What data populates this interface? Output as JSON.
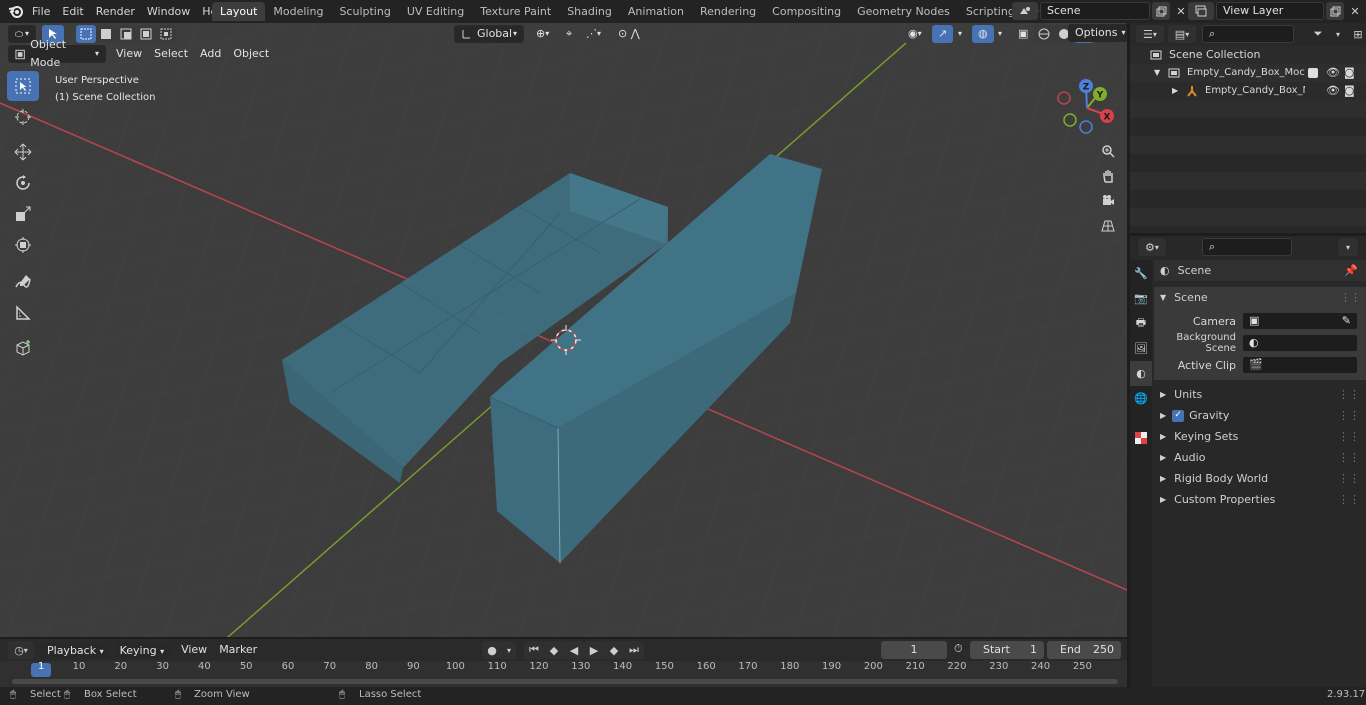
{
  "topbar": {
    "menus": [
      "File",
      "Edit",
      "Render",
      "Window",
      "Help"
    ],
    "workspaces": [
      "Layout",
      "Modeling",
      "Sculpting",
      "UV Editing",
      "Texture Paint",
      "Shading",
      "Animation",
      "Rendering",
      "Compositing",
      "Geometry Nodes",
      "Scripting"
    ],
    "active_workspace": "Layout",
    "scene_name": "Scene",
    "view_layer": "View Layer"
  },
  "viewport": {
    "mode": "Object Mode",
    "menus": [
      "View",
      "Select",
      "Add",
      "Object"
    ],
    "transform_orientation": "Global",
    "options_label": "Options",
    "overlay_line1": "User Perspective",
    "overlay_line2": "(1) Scene Collection",
    "gizmo_axes": [
      "X",
      "Y",
      "Z"
    ]
  },
  "outliner": {
    "search_placeholder": "",
    "items": [
      {
        "label": "Scene Collection"
      },
      {
        "label": "Empty_Candy_Box_Mockup_t"
      },
      {
        "label": "Empty_Candy_Box_Mock"
      }
    ]
  },
  "properties": {
    "context_label": "Scene",
    "section_label": "Scene",
    "fields": [
      {
        "label": "Camera"
      },
      {
        "label": "Background Scene"
      },
      {
        "label": "Active Clip"
      }
    ],
    "panels": [
      {
        "label": "Units"
      },
      {
        "label": "Gravity",
        "checked": true
      },
      {
        "label": "Keying Sets"
      },
      {
        "label": "Audio"
      },
      {
        "label": "Rigid Body World"
      },
      {
        "label": "Custom Properties"
      }
    ]
  },
  "timeline": {
    "menus": [
      "Playback",
      "Keying",
      "View",
      "Marker"
    ],
    "current_frame": "1",
    "start_label": "Start",
    "start_value": "1",
    "end_label": "End",
    "end_value": "250",
    "ticks": [
      "1",
      "10",
      "20",
      "30",
      "40",
      "50",
      "60",
      "70",
      "80",
      "90",
      "100",
      "110",
      "120",
      "130",
      "140",
      "150",
      "160",
      "170",
      "180",
      "190",
      "200",
      "210",
      "220",
      "230",
      "240",
      "250"
    ]
  },
  "statusbar": {
    "hints": [
      "Select",
      "Box Select",
      "Zoom View",
      "Lasso Select"
    ],
    "version": "2.93.17"
  },
  "colors": {
    "accent": "#4772b3",
    "object": "#3f6f80",
    "x_axis": "#b8454f",
    "y_axis": "#7a9a2e"
  }
}
